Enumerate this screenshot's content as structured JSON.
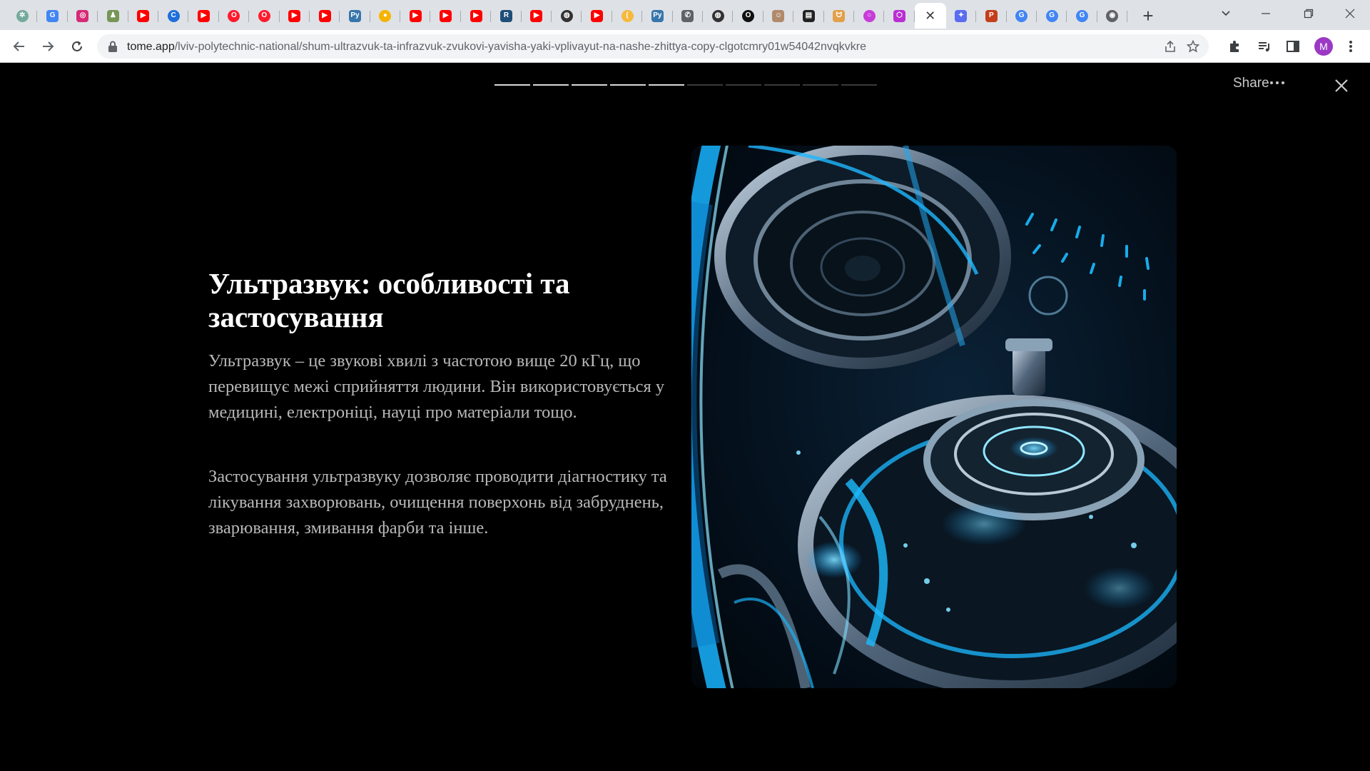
{
  "browser": {
    "active_tab_close": "✕",
    "favicons": [
      {
        "name": "chatgpt-icon",
        "bg": "#74aa9c",
        "glyph": "✲",
        "round": true
      },
      {
        "name": "google-translate-icon",
        "bg": "#4285f4",
        "glyph": "G"
      },
      {
        "name": "instagram-icon",
        "bg": "#d62976",
        "glyph": "◎"
      },
      {
        "name": "chess-icon",
        "bg": "#769656",
        "glyph": "♟"
      },
      {
        "name": "youtube-icon",
        "bg": "#ff0000",
        "glyph": "▶"
      },
      {
        "name": "c-app-icon",
        "bg": "#1e6fd9",
        "glyph": "C",
        "round": true
      },
      {
        "name": "youtube-icon",
        "bg": "#ff0000",
        "glyph": "▶"
      },
      {
        "name": "opera-icon",
        "bg": "#ff1b2d",
        "glyph": "O",
        "round": true
      },
      {
        "name": "opera-icon",
        "bg": "#ff1b2d",
        "glyph": "O",
        "round": true
      },
      {
        "name": "youtube-icon",
        "bg": "#ff0000",
        "glyph": "▶"
      },
      {
        "name": "youtube-icon",
        "bg": "#ff0000",
        "glyph": "▶"
      },
      {
        "name": "python-icon",
        "bg": "#3776ab",
        "glyph": "Py"
      },
      {
        "name": "maps-pin-icon",
        "bg": "#f4b400",
        "glyph": "●",
        "round": true
      },
      {
        "name": "youtube-icon",
        "bg": "#ff0000",
        "glyph": "▶"
      },
      {
        "name": "youtube-icon",
        "bg": "#ff0000",
        "glyph": "▶"
      },
      {
        "name": "youtube-icon",
        "bg": "#ff0000",
        "glyph": "▶"
      },
      {
        "name": "remote-desktop-icon",
        "bg": "#1f4e79",
        "glyph": "R"
      },
      {
        "name": "youtube-icon",
        "bg": "#ff0000",
        "glyph": "▶"
      },
      {
        "name": "globe-icon",
        "bg": "#333333",
        "glyph": "◍",
        "round": true
      },
      {
        "name": "youtube-icon",
        "bg": "#ff0000",
        "glyph": "▶"
      },
      {
        "name": "lens-icon",
        "bg": "#f6b93b",
        "glyph": "(",
        "round": true
      },
      {
        "name": "python-icon",
        "bg": "#3776ab",
        "glyph": "Py"
      },
      {
        "name": "phone-icon",
        "bg": "#5f6368",
        "glyph": "✆"
      },
      {
        "name": "globe-icon",
        "bg": "#333333",
        "glyph": "◍",
        "round": true
      },
      {
        "name": "o-app-icon",
        "bg": "#111111",
        "glyph": "O",
        "round": true
      },
      {
        "name": "avatar-tab-icon",
        "bg": "#b08a6a",
        "glyph": "☺"
      },
      {
        "name": "terminal-icon",
        "bg": "#222222",
        "glyph": "▤"
      },
      {
        "name": "cat-icon",
        "bg": "#e2a04a",
        "glyph": "ᗢ"
      },
      {
        "name": "ring-icon",
        "bg": "#c83cd8",
        "glyph": "○",
        "round": true
      },
      {
        "name": "hexagon-icon",
        "bg": "#b92fd1",
        "glyph": "⬡"
      },
      {
        "name": "tome-icon",
        "bg": "#ffffff",
        "glyph": "",
        "active": true
      },
      {
        "name": "bing-chat-icon",
        "bg": "#5a6cf0",
        "glyph": "✦"
      },
      {
        "name": "powerpoint-icon",
        "bg": "#c43e1c",
        "glyph": "P"
      },
      {
        "name": "google-icon",
        "bg": "#4285f4",
        "glyph": "G",
        "round": true
      },
      {
        "name": "google-icon",
        "bg": "#4285f4",
        "glyph": "G",
        "round": true
      },
      {
        "name": "google-icon",
        "bg": "#4285f4",
        "glyph": "G",
        "round": true
      },
      {
        "name": "chrome-icon",
        "bg": "#5f6368",
        "glyph": "◉",
        "round": true
      }
    ],
    "url_host": "tome.app",
    "url_path": "/lviv-polytechnic-national/shum-ultrazvuk-ta-infrazvuk-zvukovi-yavisha-yaki-vplivayut-na-nashe-zhittya-copy-clgotcmry01w54042nvqkvkre",
    "profile_initial": "M",
    "profile_color": "#9b39c4"
  },
  "presentation": {
    "progress": {
      "total": 10,
      "current": 5
    },
    "share_label": "Share",
    "slide": {
      "title": "Ультразвук: особливості та застосування",
      "paragraphs": [
        "Ультразвук – це звукові хвилі з частотою вище 20 кГц, що перевищує межі сприйняття людини. Він використовується у медицині, електроніці, науці про матеріали тощо.",
        "Застосування ультразвуку дозволяє проводити діагностику та лікування захворювань, очищення поверхонь від забруднень, зварювання, змивання фарби та інше."
      ],
      "image_accent": "#19b8ff"
    }
  }
}
